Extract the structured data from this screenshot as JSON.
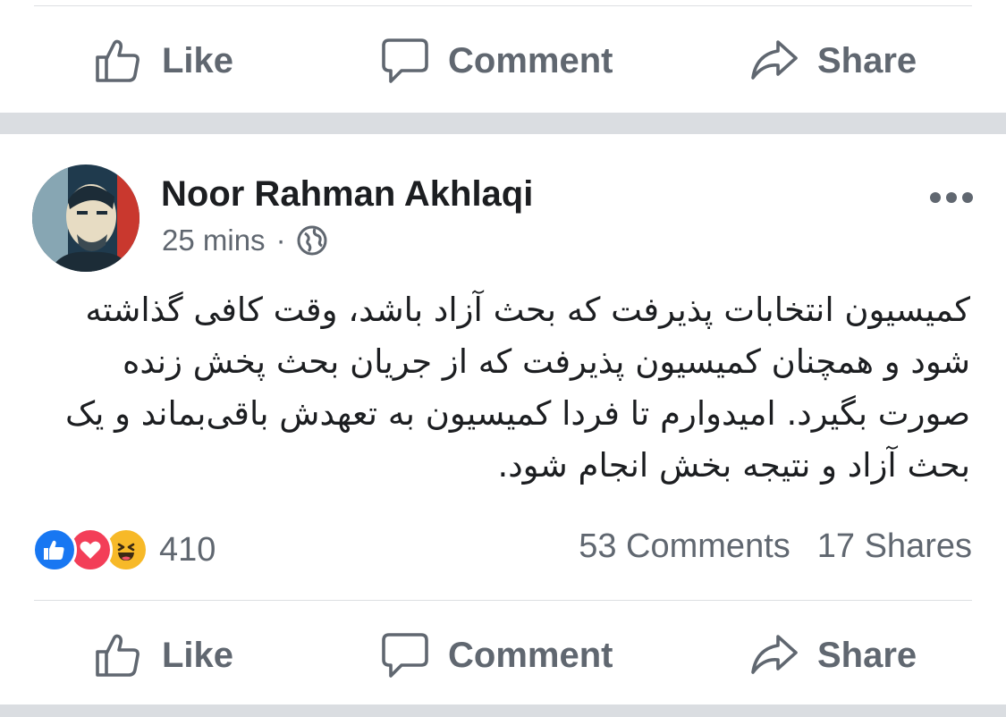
{
  "actions": {
    "like_label": "Like",
    "comment_label": "Comment",
    "share_label": "Share"
  },
  "post": {
    "author": "Noor Rahman Akhlaqi",
    "time": "25 mins",
    "separator": "·",
    "privacy_icon": "globe-icon",
    "text": "کمیسیون انتخابات پذیرفت که بحث آزاد باشد، وقت کافی گذاشته شود و همچنان کمیسیون پذیرفت که از جریان بحث پخش زنده صورت بگیرد. امیدوارم تا فردا کمیسیون به تعهدش باقی‌بماند و یک بحث آزاد و نتیجه بخش انجام شود.",
    "reaction_icons": [
      "like-reaction-icon",
      "love-reaction-icon",
      "haha-reaction-icon"
    ],
    "reaction_count": "410",
    "comments": "53 Comments",
    "shares": "17 Shares"
  },
  "colors": {
    "text_primary": "#1c1e21",
    "text_secondary": "#606770",
    "band": "#dadde1",
    "like_blue": "#1877f2",
    "love_red": "#f33e58",
    "haha_yellow": "#f7b928"
  }
}
